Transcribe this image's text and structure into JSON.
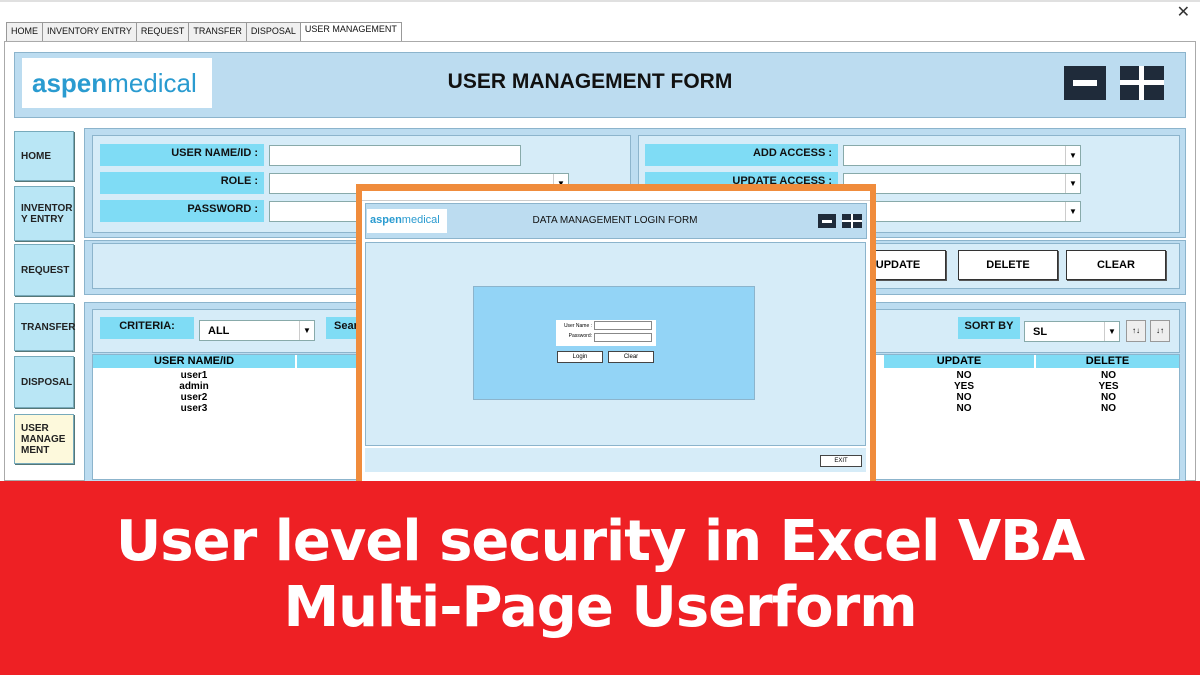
{
  "window": {
    "close_glyph": "✕"
  },
  "tabs": [
    "HOME",
    "INVENTORY ENTRY",
    "REQUEST",
    "TRANSFER",
    "DISPOSAL",
    "USER MANAGEMENT"
  ],
  "header": {
    "logo_bold": "aspen",
    "logo_rest": "medical",
    "title": "USER MANAGEMENT FORM"
  },
  "sidebar": [
    "HOME",
    "INVENTOR Y ENTRY",
    "REQUEST",
    "TRANSFER",
    "DISPOSAL",
    "USER MANAGE MENT"
  ],
  "form": {
    "username_label": "USER NAME/ID :",
    "role_label": "ROLE :",
    "password_label": "PASSWORD :",
    "add_access_label": "ADD ACCESS :",
    "update_access_label": "UPDATE ACCESS :"
  },
  "buttons": {
    "update": "UPDATE",
    "delete": "DELETE",
    "clear": "CLEAR"
  },
  "filter": {
    "criteria_label": "CRITERIA:",
    "criteria_value": "ALL",
    "search_label": "Sear",
    "sort_label": "SORT BY",
    "sort_value": "SL"
  },
  "table": {
    "headers": {
      "username": "USER NAME/ID",
      "update": "UPDATE",
      "delete": "DELETE"
    },
    "rows": [
      {
        "username": "user1",
        "update": "NO",
        "delete": "NO"
      },
      {
        "username": "admin",
        "update": "YES",
        "delete": "YES"
      },
      {
        "username": "user2",
        "update": "NO",
        "delete": "NO"
      },
      {
        "username": "user3",
        "update": "NO",
        "delete": "NO"
      }
    ]
  },
  "login": {
    "logo_bold": "aspen",
    "logo_rest": "medical",
    "title": "DATA MANAGEMENT LOGIN FORM",
    "username_label": "User Name :",
    "password_label": "Password:",
    "login_button": "Login",
    "clear_button": "Clear",
    "exit_button": "EXIT"
  },
  "banner": {
    "line1": "User level security in Excel VBA",
    "line2": "Multi-Page Userform"
  },
  "colors": {
    "accent_red": "#ee2024",
    "panel_blue": "#bcdcf0",
    "label_cyan": "#7fdcf5",
    "modal_orange": "#f08c3c",
    "logo_blue": "#2a9bd0"
  }
}
